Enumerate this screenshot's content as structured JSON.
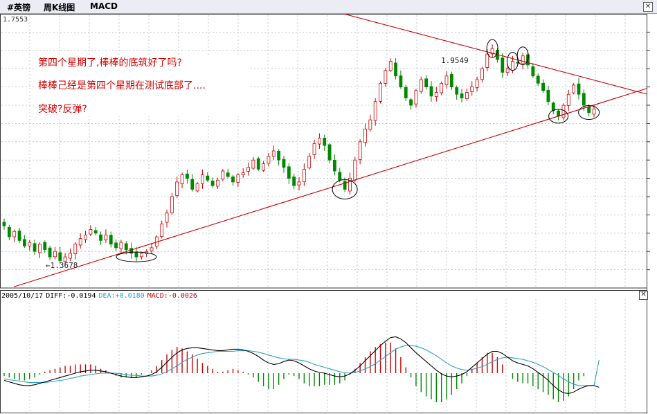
{
  "header": {
    "symbol": "#英镑",
    "period": "周K线图",
    "indicator": "MACD",
    "close_icon": "close-icon"
  },
  "price_panel": {
    "top_value": "1.7553",
    "high_label": "1.9549",
    "low_label": "←1.3678",
    "annotations": [
      "第四个星期了,棒棒的底筑好了吗?",
      "棒棒己经是第四个星期在测试底部了....",
      "突破?反弹?"
    ],
    "colors": {
      "up": "#cc0000",
      "down": "#008800",
      "trendline": "#cc0000",
      "grid": "#9aa4b8"
    }
  },
  "indicator_panel": {
    "date": "2005/10/17",
    "diff_label": "DIFF:-0.0194",
    "dea_label": "DEA:+0.0180",
    "macd_label": "MACD:-0.0026",
    "colors": {
      "diff": "#000000",
      "dea": "#2aa0c8",
      "macd_pos": "#cc0000",
      "macd_neg": "#008800",
      "date": "#000000",
      "diff_text": "#000000",
      "dea_text": "#2aa0c8",
      "macd_text": "#cc0000"
    }
  },
  "chart_data": [
    {
      "type": "candlestick",
      "title": "",
      "xlabel": "",
      "ylabel": "",
      "ylim": [
        1.3,
        2.05
      ],
      "labels": {
        "high": 1.9549,
        "low": 1.3678,
        "top_axis": 1.7553
      },
      "close_values": [
        1.47,
        1.44,
        1.455,
        1.43,
        1.415,
        1.425,
        1.4,
        1.42,
        1.405,
        1.385,
        1.4,
        1.375,
        1.385,
        1.395,
        1.42,
        1.435,
        1.445,
        1.46,
        1.45,
        1.43,
        1.445,
        1.42,
        1.41,
        1.425,
        1.405,
        1.395,
        1.385,
        1.395,
        1.4,
        1.41,
        1.44,
        1.475,
        1.505,
        1.55,
        1.59,
        1.61,
        1.6,
        1.57,
        1.585,
        1.61,
        1.595,
        1.58,
        1.595,
        1.62,
        1.605,
        1.59,
        1.61,
        1.615,
        1.63,
        1.65,
        1.625,
        1.64,
        1.66,
        1.675,
        1.65,
        1.63,
        1.6,
        1.58,
        1.59,
        1.625,
        1.66,
        1.695,
        1.71,
        1.69,
        1.65,
        1.62,
        1.595,
        1.57,
        1.6,
        1.65,
        1.7,
        1.735,
        1.76,
        1.81,
        1.86,
        1.895,
        1.92,
        1.88,
        1.85,
        1.82,
        1.8,
        1.84,
        1.87,
        1.85,
        1.825,
        1.835,
        1.86,
        1.88,
        1.85,
        1.83,
        1.82,
        1.835,
        1.85,
        1.87,
        1.9,
        1.94,
        1.955,
        1.925,
        1.89,
        1.9,
        1.92,
        1.915,
        1.935,
        1.91,
        1.88,
        1.86,
        1.84,
        1.81,
        1.785,
        1.77,
        1.8,
        1.83,
        1.855,
        1.83,
        1.8,
        1.78,
        1.79
      ],
      "trendlines": [
        {
          "name": "",
          "from": [
            0,
            1.295
          ],
          "to": [
            117,
            1.805
          ]
        },
        {
          "name": "",
          "from": [
            79,
            2.005
          ],
          "to": [
            117,
            1.865
          ]
        }
      ]
    },
    {
      "type": "bar+line",
      "title": "",
      "series": [
        {
          "name": "DIFF",
          "values": [
            -0.01,
            -0.012,
            -0.014,
            -0.016,
            -0.017,
            -0.017,
            -0.016,
            -0.014,
            -0.012,
            -0.01,
            -0.008,
            -0.006,
            -0.004,
            -0.002,
            0.0,
            0.002,
            0.003,
            0.004,
            0.004,
            0.003,
            0.002,
            0.0,
            -0.002,
            -0.004,
            -0.005,
            -0.006,
            -0.006,
            -0.005,
            -0.004,
            -0.002,
            0.002,
            0.008,
            0.015,
            0.022,
            0.028,
            0.032,
            0.034,
            0.035,
            0.035,
            0.034,
            0.033,
            0.032,
            0.031,
            0.031,
            0.032,
            0.033,
            0.033,
            0.032,
            0.03,
            0.027,
            0.023,
            0.018,
            0.014,
            0.012,
            0.013,
            0.016,
            0.018,
            0.017,
            0.014,
            0.01,
            0.006,
            0.003,
            0.001,
            0.0,
            -0.002,
            -0.004,
            -0.005,
            -0.004,
            -0.001,
            0.004,
            0.01,
            0.017,
            0.024,
            0.031,
            0.038,
            0.044,
            0.049,
            0.05,
            0.047,
            0.042,
            0.035,
            0.028,
            0.022,
            0.016,
            0.01,
            0.004,
            -0.001,
            -0.004,
            -0.005,
            -0.004,
            -0.002,
            0.002,
            0.008,
            0.014,
            0.02,
            0.026,
            0.03,
            0.03,
            0.027,
            0.022,
            0.017,
            0.014,
            0.012,
            0.01,
            0.006,
            0.001,
            -0.004,
            -0.01,
            -0.017,
            -0.023,
            -0.027,
            -0.028,
            -0.026,
            -0.022,
            -0.019,
            -0.017,
            -0.017,
            -0.0194
          ]
        },
        {
          "name": "DEA",
          "values": [
            -0.008,
            -0.009,
            -0.01,
            -0.011,
            -0.012,
            -0.013,
            -0.013,
            -0.013,
            -0.013,
            -0.012,
            -0.011,
            -0.01,
            -0.009,
            -0.007,
            -0.006,
            -0.004,
            -0.003,
            -0.002,
            -0.001,
            0.0,
            0.0,
            0.0,
            0.0,
            -0.001,
            -0.002,
            -0.003,
            -0.003,
            -0.004,
            -0.004,
            -0.004,
            -0.003,
            -0.001,
            0.002,
            0.006,
            0.01,
            0.015,
            0.019,
            0.022,
            0.025,
            0.027,
            0.028,
            0.029,
            0.03,
            0.03,
            0.03,
            0.03,
            0.031,
            0.031,
            0.031,
            0.03,
            0.029,
            0.027,
            0.025,
            0.023,
            0.021,
            0.02,
            0.019,
            0.019,
            0.018,
            0.017,
            0.015,
            0.012,
            0.01,
            0.008,
            0.006,
            0.004,
            0.002,
            0.001,
            0.0,
            0.001,
            0.003,
            0.006,
            0.009,
            0.013,
            0.018,
            0.023,
            0.028,
            0.033,
            0.036,
            0.038,
            0.038,
            0.037,
            0.035,
            0.032,
            0.028,
            0.024,
            0.019,
            0.014,
            0.01,
            0.007,
            0.005,
            0.004,
            0.005,
            0.007,
            0.009,
            0.012,
            0.016,
            0.019,
            0.021,
            0.022,
            0.021,
            0.02,
            0.019,
            0.017,
            0.015,
            0.012,
            0.009,
            0.005,
            0.001,
            -0.003,
            -0.008,
            -0.012,
            -0.015,
            -0.017,
            -0.017,
            -0.017,
            -0.017,
            0.018
          ]
        }
      ]
    }
  ]
}
